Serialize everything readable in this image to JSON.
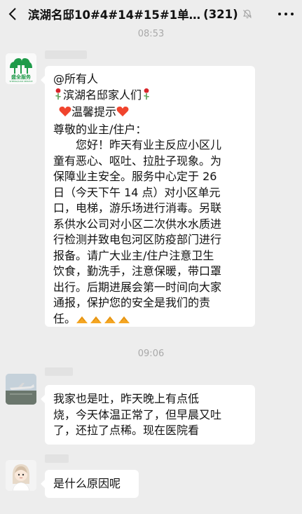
{
  "nav": {
    "back_icon": "chevron-left-icon",
    "title": "滨湖名邸10#4#14#15#1单…",
    "member_count": "(321)",
    "mute_icon": "bell-off-icon",
    "more_icon": "more-dots-icon"
  },
  "messages": [
    {
      "timestamp": "08:53",
      "avatar_text": "盛全服务",
      "avatar_subtext": "SHENGQUAN SERVICE",
      "lines": {
        "l1": "@所有人",
        "l2": "滨湖名邸家人们",
        "l3": "温馨提示",
        "l4": "尊敬的业主/住户：",
        "l5": "您好！昨天有业主反应小区儿",
        "l6": "童有恶心、呕吐、拉肚子现象。为",
        "l7": "保障业主安全。服务中心定于 26",
        "l8": "日（今天下午 14 点）对小区单元",
        "l9": "口，电梯，游乐场进行消毒。另联",
        "l10": "系供水公司对小区二次供水水质进",
        "l11": "行检测并致电包河区防疫部门进行",
        "l12": "报备。请广大业主/住户注意卫生",
        "l13": "饮食，勤洗手，注意保暖，带口罩",
        "l14": "出行。后期进展会第一时间向大家",
        "l15": "通报，保护您的安全是我们的责",
        "l16": "任。"
      }
    },
    {
      "timestamp": "09:06",
      "lines": {
        "l1": " 我家也是吐，昨天晚上有点低",
        "l2": "烧，今天体温正常了，但早晨又吐",
        "l3": "了，还拉了点稀。现在医院看"
      }
    },
    {
      "lines": {
        "l1": "是什么原因呢"
      }
    }
  ],
  "colors": {
    "background": "#ededed",
    "bubble": "#ffffff",
    "timestamp": "#a9a9a9",
    "logo_green": "#1f9b4a",
    "rose_red": "#d8262b",
    "heart_red": "#f0442d",
    "hands_orange": "#f5a623"
  }
}
